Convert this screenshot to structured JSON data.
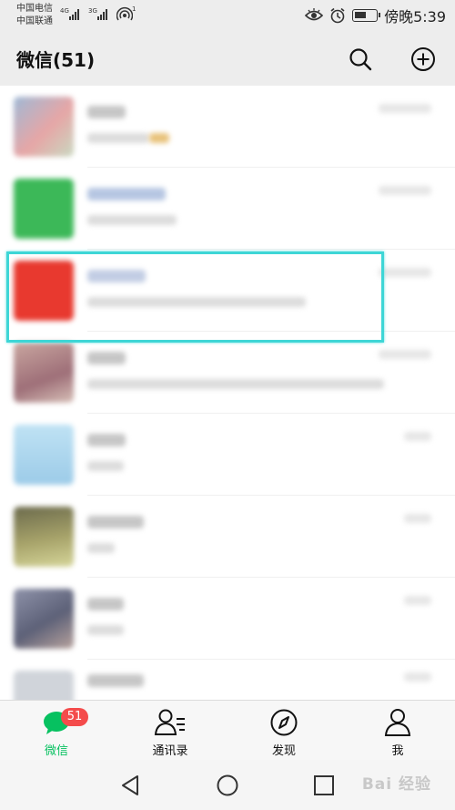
{
  "status_bar": {
    "carrier_1": "中国电信",
    "carrier_2": "中国联通",
    "network_1": "4G",
    "network_2": "3G",
    "hotspot_count": "1",
    "time": "傍晚5:39",
    "battery_level": 0.55,
    "icons": [
      "eye-icon",
      "alarm-icon",
      "battery-icon",
      "hotspot-icon"
    ]
  },
  "header": {
    "title": "微信(51)",
    "search_icon": "search-icon",
    "add_icon": "plus-circle-icon"
  },
  "chat_list": {
    "note": "",
    "rows": [
      {
        "avatar_color": "#9fb9d6"
      },
      {
        "avatar_color": "#3cb858"
      },
      {
        "avatar_color": "#e8392f"
      },
      {
        "avatar_color": "#b98b8f"
      },
      {
        "avatar_color": "#a9d4ee"
      },
      {
        "avatar_color": "#8b8f5a"
      },
      {
        "avatar_color": "#7c7f98"
      },
      {
        "avatar_color": "#d0d4da"
      }
    ]
  },
  "tab_bar": {
    "tabs": [
      {
        "label": "微信",
        "icon": "chat-bubble-icon",
        "badge": "51",
        "active": true
      },
      {
        "label": "通讯录",
        "icon": "contacts-icon",
        "active": false
      },
      {
        "label": "发现",
        "icon": "compass-icon",
        "active": false
      },
      {
        "label": "我",
        "icon": "person-icon",
        "active": false
      }
    ]
  },
  "nav_bar": {
    "back_icon": "triangle-back-icon",
    "home_icon": "circle-home-icon",
    "recents_icon": "square-recents-icon",
    "watermark": "Bai 经验"
  },
  "colors": {
    "accent_green": "#07c160",
    "badge_red": "#f44b4b",
    "highlight_cyan": "#3ed6d6"
  }
}
